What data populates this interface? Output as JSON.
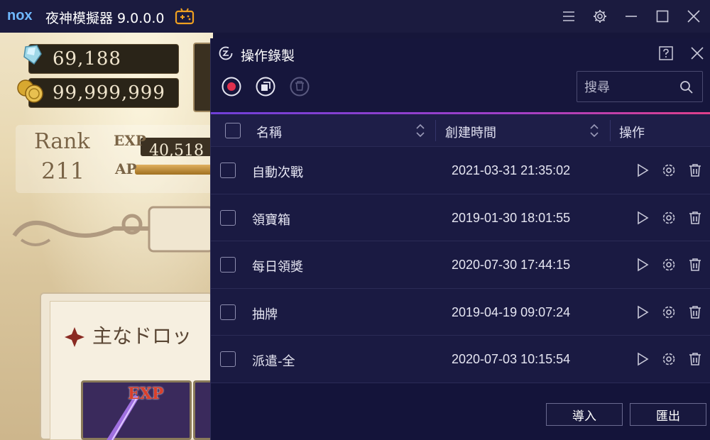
{
  "app": {
    "logo_text": "nox",
    "title": "夜神模擬器 9.0.0.0",
    "icons": [
      "gamepad-icon",
      "menu-icon",
      "gear-icon",
      "minimize-icon",
      "maximize-icon",
      "close-icon"
    ]
  },
  "game": {
    "crystals": "69,188",
    "coins": "99,999,999",
    "rank_label": "Rank",
    "rank_value": "211",
    "exp_label": "EXP",
    "exp_value": "40,518",
    "ap_label": "AP",
    "drop_title": "主なドロッ",
    "item_label": "EXP"
  },
  "dialog": {
    "title": "操作錄製",
    "search_placeholder": "搜尋",
    "toolbar": [
      "record-icon",
      "merge-icon",
      "delete-icon"
    ],
    "columns": {
      "name": "名稱",
      "created": "創建時間",
      "actions": "操作"
    },
    "rows": [
      {
        "name": "自動次戰",
        "created": "2021-03-31 21:35:02"
      },
      {
        "name": "領寶箱",
        "created": "2019-01-30 18:01:55"
      },
      {
        "name": "每日領獎",
        "created": "2020-07-30 17:44:15"
      },
      {
        "name": "抽牌",
        "created": "2019-04-19 09:07:24"
      },
      {
        "name": "派遣-全",
        "created": "2020-07-03 10:15:54"
      }
    ],
    "import_label": "導入",
    "export_label": "匯出"
  },
  "colors": {
    "accent_record": "#e0304e",
    "accent_gradient_start": "#7040d8",
    "accent_gradient_end": "#e0408a"
  }
}
